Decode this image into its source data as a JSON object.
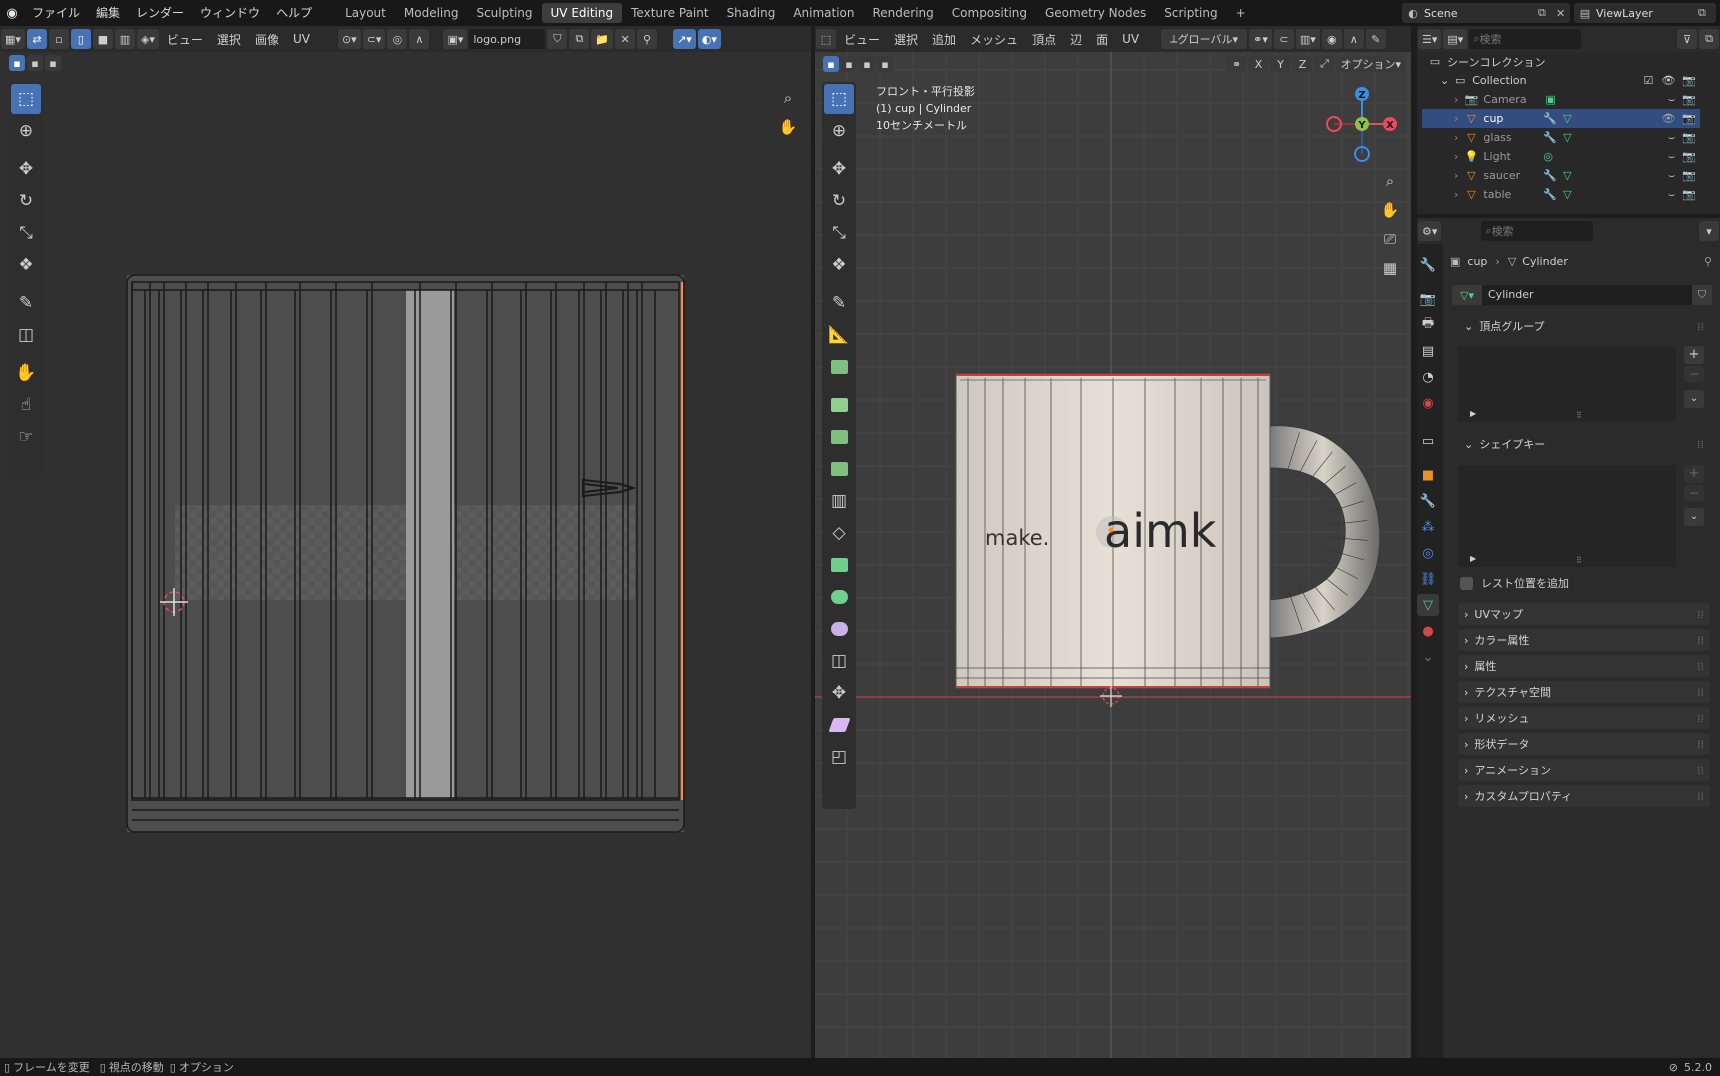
{
  "topbar": {
    "menus": [
      "ファイル",
      "編集",
      "レンダー",
      "ウィンドウ",
      "ヘルプ"
    ],
    "workspaces": [
      "Layout",
      "Modeling",
      "Sculpting",
      "UV Editing",
      "Texture Paint",
      "Shading",
      "Animation",
      "Rendering",
      "Compositing",
      "Geometry Nodes",
      "Scripting"
    ],
    "active_workspace": "UV Editing",
    "add_tab": "+",
    "scene": "Scene",
    "viewlayer": "ViewLayer"
  },
  "uv_editor": {
    "menus": [
      "ビュー",
      "選択",
      "画像",
      "UV"
    ],
    "image_name": "logo.png"
  },
  "viewport": {
    "menus": [
      "ビュー",
      "選択",
      "追加",
      "メッシュ",
      "頂点",
      "辺",
      "面",
      "UV"
    ],
    "transform_orientation": "グローバル",
    "axes": [
      "X",
      "Y",
      "Z"
    ],
    "options": "オプション",
    "info_line1": "フロント・平行投影",
    "info_line2": "(1) cup | Cylinder",
    "info_line3": "10センチメートル",
    "logo_text_left": "make.",
    "logo_text_right": "aimk",
    "gizmo": {
      "z": "Z",
      "y": "Y",
      "x": "X"
    }
  },
  "outliner": {
    "search_placeholder": "検索",
    "root": "シーンコレクション",
    "collection": "Collection",
    "items": [
      {
        "name": "Camera",
        "type": "camera",
        "selected": false
      },
      {
        "name": "cup",
        "type": "mesh",
        "selected": true
      },
      {
        "name": "glass",
        "type": "mesh",
        "selected": false
      },
      {
        "name": "Light",
        "type": "light",
        "selected": false
      },
      {
        "name": "saucer",
        "type": "mesh",
        "selected": false
      },
      {
        "name": "table",
        "type": "mesh",
        "selected": false
      }
    ]
  },
  "properties": {
    "search_placeholder": "検索",
    "breadcrumb_object": "cup",
    "breadcrumb_data": "Cylinder",
    "data_name": "Cylinder",
    "sections": {
      "vertex_groups": "頂点グループ",
      "shape_keys": "シェイプキー",
      "rest_position": "レスト位置を追加",
      "collapsed": [
        "UVマップ",
        "カラー属性",
        "属性",
        "テクスチャ空間",
        "リメッシュ",
        "形状データ",
        "アニメーション",
        "カスタムプロパティ"
      ]
    }
  },
  "status": {
    "items": [
      "フレームを変更",
      "視点の移動",
      "オプション"
    ],
    "version": "5.2.0"
  },
  "colors": {
    "accent": "#4772b3",
    "selected_row": "#334d80",
    "axis_x": "#e84a5f",
    "axis_y": "#8bc34a",
    "axis_z": "#3b8ee8",
    "outline": "#ff8c1a"
  }
}
